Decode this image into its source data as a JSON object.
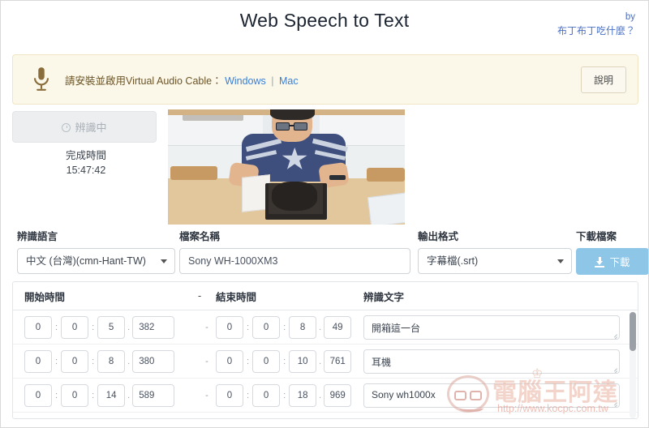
{
  "header": {
    "title": "Web Speech to Text",
    "by_label": "by",
    "by_name": "布丁布丁吃什麼？"
  },
  "alert": {
    "icon": "microphone-icon",
    "message": "請安裝並啟用Virtual Audio Cable：",
    "link_windows": "Windows",
    "separator": "|",
    "link_mac": "Mac",
    "help_button": "說明",
    "bg_color": "#fcf8e9",
    "border_color": "#f0e5c4",
    "text_color": "#6b5426"
  },
  "status": {
    "record_button": "辨識中",
    "record_icon": "clock-spinner-icon",
    "finish_label": "完成時間",
    "finish_time": "15:47:42"
  },
  "video": {
    "name": "video-preview-frame"
  },
  "controls": {
    "language": {
      "label": "辨識語言",
      "value": "中文 (台灣)(cmn-Hant-TW)"
    },
    "filename": {
      "label": "檔案名稱",
      "value": "Sony WH-1000XM3",
      "placeholder": "檔案名稱"
    },
    "format": {
      "label": "輸出格式",
      "value": "字幕檔(.srt)"
    },
    "download": {
      "label": "下載檔案",
      "button": "下載",
      "icon": "download-icon",
      "color": "#8ec6e8"
    }
  },
  "table": {
    "headers": {
      "start": "開始時間",
      "dash": "-",
      "end": "結束時間",
      "text": "辨識文字"
    },
    "rows": [
      {
        "start": {
          "h": "0",
          "m": "0",
          "s": "5",
          "ms": "382"
        },
        "dash": "-",
        "end": {
          "h": "0",
          "m": "0",
          "s": "8",
          "ms": "49"
        },
        "text": "開箱這一台"
      },
      {
        "start": {
          "h": "0",
          "m": "0",
          "s": "8",
          "ms": "380"
        },
        "dash": "-",
        "end": {
          "h": "0",
          "m": "0",
          "s": "10",
          "ms": "761"
        },
        "text": "耳機"
      },
      {
        "start": {
          "h": "0",
          "m": "0",
          "s": "14",
          "ms": "589"
        },
        "dash": "-",
        "end": {
          "h": "0",
          "m": "0",
          "s": "18",
          "ms": "969"
        },
        "text": "Sony wh1000x"
      }
    ],
    "time_sep": ":",
    "ms_sep": "."
  },
  "watermark": {
    "title": "電腦王阿達",
    "url": "http://www.kocpc.com.tw",
    "crown": "♔"
  }
}
